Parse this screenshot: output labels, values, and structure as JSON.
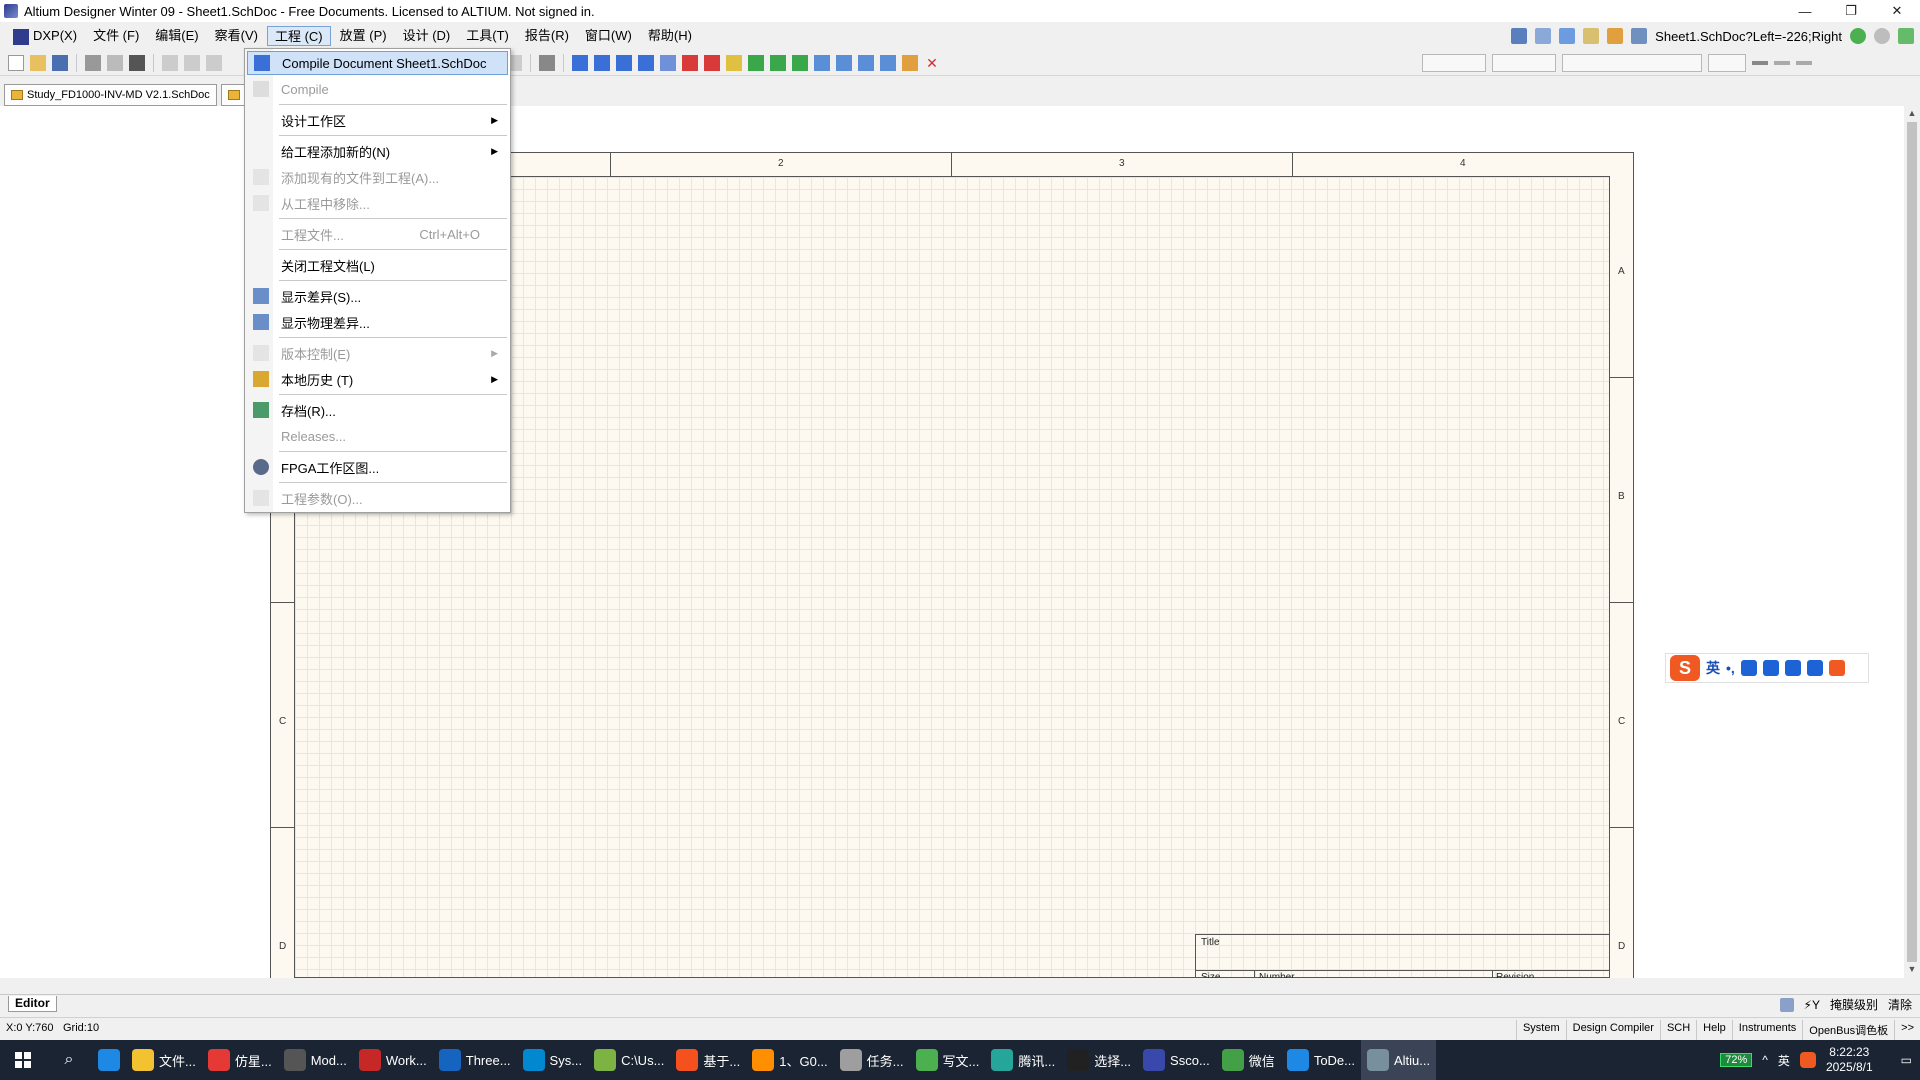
{
  "window": {
    "title": "Altium Designer Winter 09 - Sheet1.SchDoc - Free Documents. Licensed to ALTIUM. Not signed in.",
    "controls": [
      "—",
      "❐",
      "✕"
    ]
  },
  "menubar": {
    "items": [
      "DXP(X)",
      "文件 (F)",
      "编辑(E)",
      "察看(V)",
      "工程 (C)",
      "放置 (P)",
      "设计 (D)",
      "工具(T)",
      "报告(R)",
      "窗口(W)",
      "帮助(H)"
    ],
    "active_index": 4,
    "sheet_indicator": "Sheet1.SchDoc?Left=-226;Right"
  },
  "doctabs": [
    "Study_FD1000-INV-MD V2.1.SchDoc",
    "S"
  ],
  "project_menu": {
    "items": [
      {
        "label": "Compile Document Sheet1.SchDoc",
        "enabled": true,
        "highlighted": true,
        "icon": "compile-icon"
      },
      {
        "label": "Compile",
        "enabled": false
      },
      {
        "label": "设计工作区",
        "enabled": true,
        "submenu": true
      },
      {
        "label": "给工程添加新的(N)",
        "enabled": true,
        "submenu": true
      },
      {
        "label": "添加现有的文件到工程(A)...",
        "enabled": false,
        "icon": "add-file-icon"
      },
      {
        "label": "从工程中移除...",
        "enabled": false,
        "icon": "remove-file-icon"
      },
      {
        "label": "工程文件...",
        "enabled": false,
        "shortcut": "Ctrl+Alt+O"
      },
      {
        "label": "关闭工程文档(L)",
        "enabled": true
      },
      {
        "label": "显示差异(S)...",
        "enabled": true,
        "icon": "diff-icon"
      },
      {
        "label": "显示物理差异...",
        "enabled": true,
        "icon": "physical-diff-icon"
      },
      {
        "label": "版本控制(E)",
        "enabled": false,
        "submenu": true,
        "icon": "lock-icon"
      },
      {
        "label": "本地历史 (T)",
        "enabled": true,
        "submenu": true,
        "icon": "history-icon"
      },
      {
        "label": "存档(R)...",
        "enabled": true,
        "icon": "archive-icon"
      },
      {
        "label": "Releases...",
        "enabled": false
      },
      {
        "label": "FPGA工作区图...",
        "enabled": true,
        "icon": "fpga-icon"
      },
      {
        "label": "工程参数(O)...",
        "enabled": false,
        "icon": "params-icon"
      }
    ]
  },
  "sheet": {
    "columns": [
      "2",
      "3",
      "4"
    ],
    "rows": [
      "A",
      "B",
      "C",
      "D"
    ],
    "title_label": "Title",
    "size_label": "Size",
    "number_label": "Number",
    "revision_label": "Revision"
  },
  "ime": {
    "lang": "英",
    "punct": "•,"
  },
  "editorbar": {
    "tab": "Editor",
    "mask_level": "掩膜级别",
    "clear": "清除"
  },
  "status": {
    "coords": "X:0 Y:760",
    "grid": "Grid:10",
    "panels": [
      "System",
      "Design Compiler",
      "SCH",
      "Help",
      "Instruments",
      "OpenBus调色板",
      ">>"
    ]
  },
  "taskbar": {
    "apps": [
      {
        "label": "",
        "color": "#1e88e5"
      },
      {
        "label": "文件...",
        "color": "#f2c230"
      },
      {
        "label": "仿星...",
        "color": "#e53935"
      },
      {
        "label": "Mod...",
        "color": "#555555"
      },
      {
        "label": "Work...",
        "color": "#c62828"
      },
      {
        "label": "Three...",
        "color": "#1565c0"
      },
      {
        "label": "Sys...",
        "color": "#0288d1"
      },
      {
        "label": "C:\\Us...",
        "color": "#7cb342"
      },
      {
        "label": "基于...",
        "color": "#f4511e"
      },
      {
        "label": "1、G0...",
        "color": "#ff8f00"
      },
      {
        "label": "任务...",
        "color": "#9e9e9e"
      },
      {
        "label": "写文...",
        "color": "#4caf50"
      },
      {
        "label": "腾讯...",
        "color": "#26a69a"
      },
      {
        "label": "选择...",
        "color": "#212121"
      },
      {
        "label": "Ssco...",
        "color": "#3949ab"
      },
      {
        "label": "微信",
        "color": "#43a047"
      },
      {
        "label": "ToDe...",
        "color": "#1e88e5"
      },
      {
        "label": "Altiu...",
        "color": "#78909c"
      }
    ],
    "battery": "72%",
    "ime_lang": "英",
    "time": "8:22:23",
    "date": "2025/8/1"
  }
}
